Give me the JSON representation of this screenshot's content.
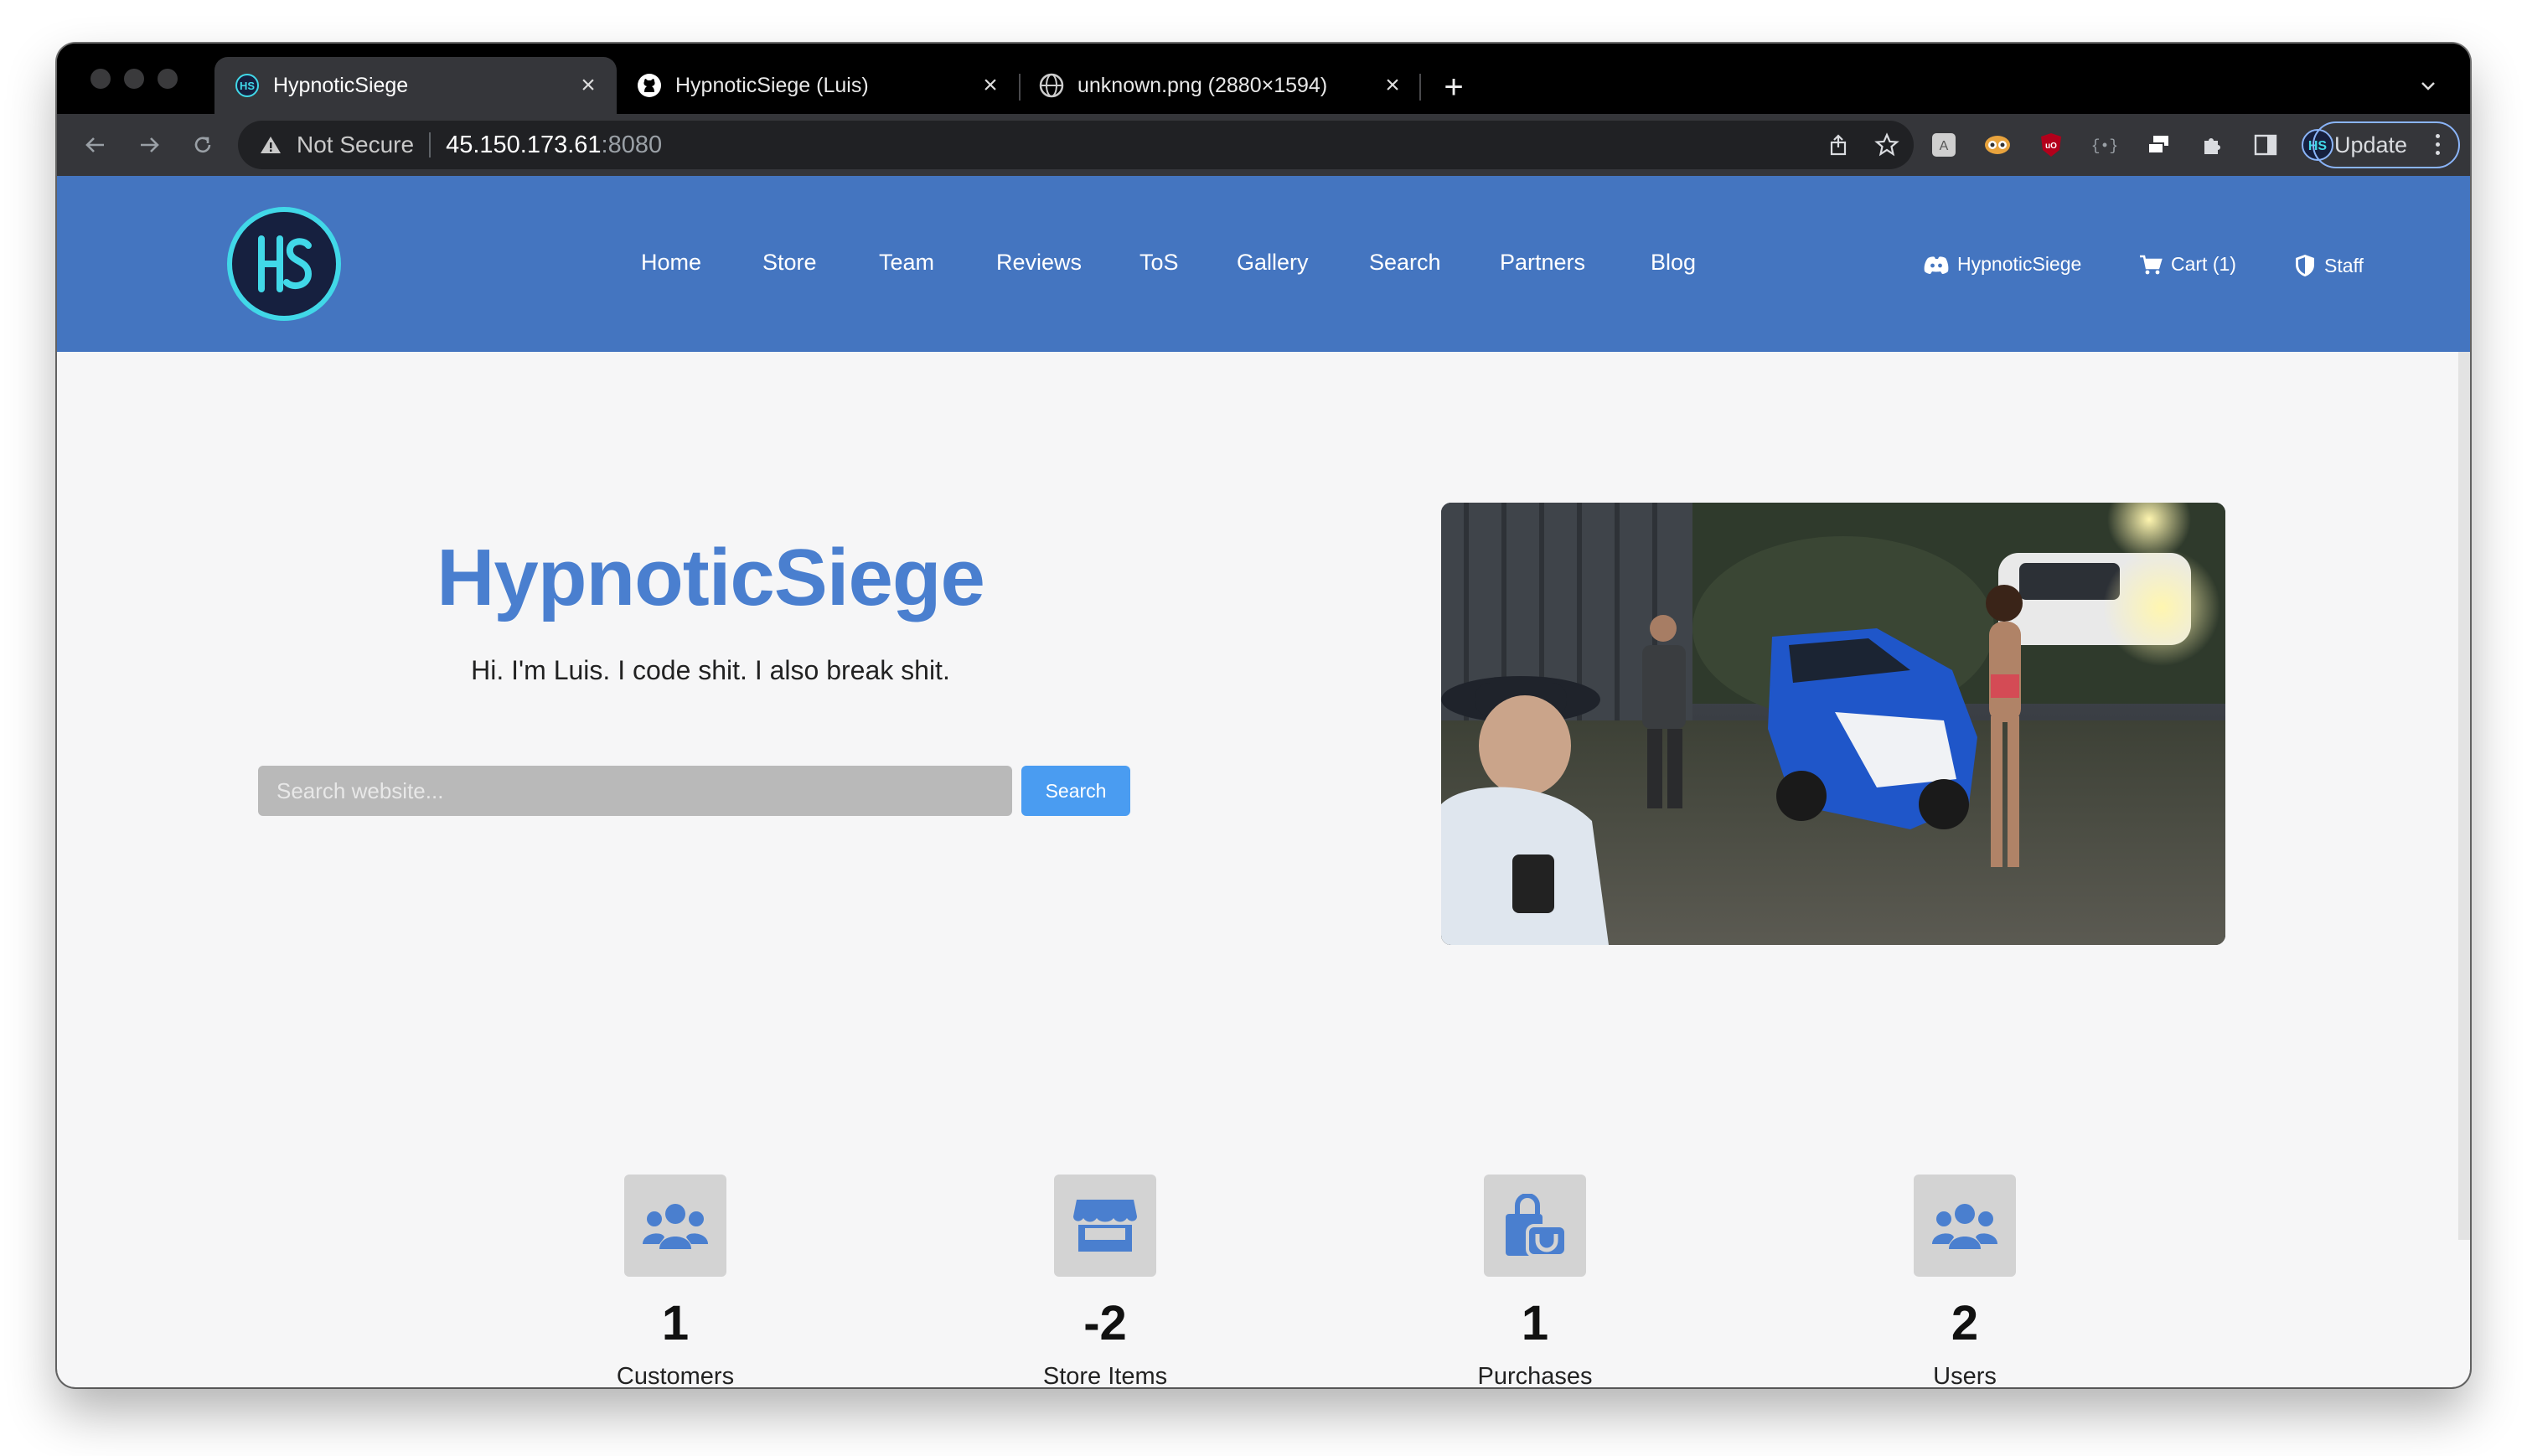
{
  "browser": {
    "tabs": [
      {
        "title": "HypnoticSiege",
        "active": true,
        "favicon": "hs-logo-icon"
      },
      {
        "title": "HypnoticSiege (Luis)",
        "active": false,
        "favicon": "github-icon"
      },
      {
        "title": "unknown.png (2880×1594)",
        "active": false,
        "favicon": "globe-icon"
      }
    ],
    "address": {
      "security_label": "Not Secure",
      "host": "45.150.173.61",
      "port": ":8080"
    },
    "update_label": "Update"
  },
  "site": {
    "nav": [
      "Home",
      "Store",
      "Team",
      "Reviews",
      "ToS",
      "Gallery",
      "Search",
      "Partners",
      "Blog"
    ],
    "right_nav": {
      "discord_label": "HypnoticSiege",
      "cart_label": "Cart (1)",
      "staff_label": "Staff"
    },
    "hero": {
      "title": "HypnoticSiege",
      "subtitle": "Hi. I'm Luis. I code shit. I also break shit.",
      "search_placeholder": "Search website...",
      "search_button": "Search"
    },
    "stats": [
      {
        "value": "1",
        "label": "Customers",
        "icon": "users-icon"
      },
      {
        "value": "-2",
        "label": "Store Items",
        "icon": "store-icon"
      },
      {
        "value": "1",
        "label": "Purchases",
        "icon": "shopping-bag-icon"
      },
      {
        "value": "2",
        "label": "Users",
        "icon": "users-icon"
      }
    ]
  },
  "colors": {
    "header": "#4475c0",
    "accent": "#4a7fcf",
    "button": "#4a9cf1",
    "logo_ring": "#41d8e8"
  }
}
